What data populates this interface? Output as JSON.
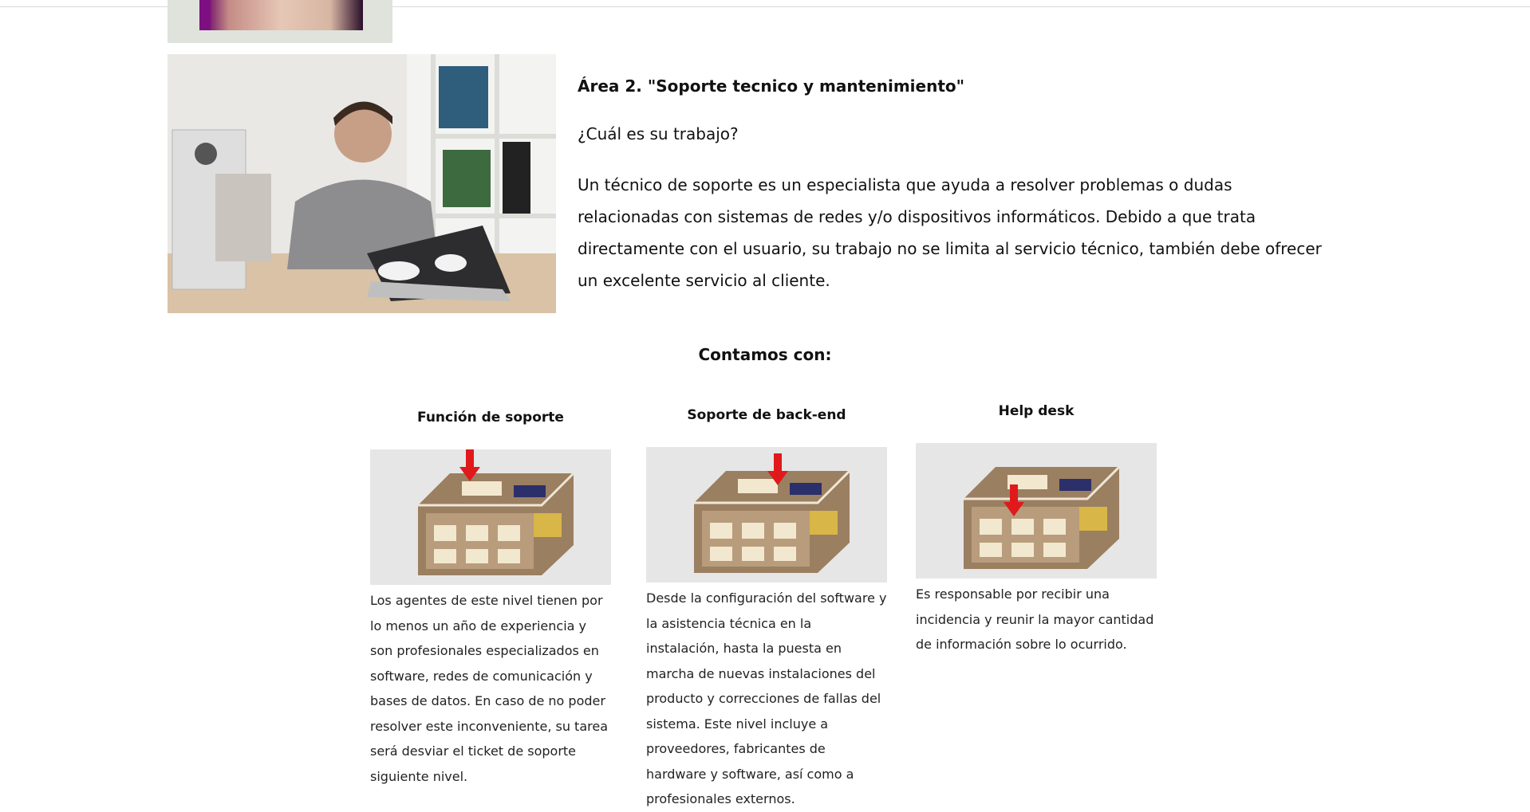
{
  "article": {
    "area_title": "Área 2. \"Soporte tecnico y mantenimiento\"",
    "question": "¿Cuál es su trabajo?",
    "body": "Un técnico de soporte es un especialista que ayuda a resolver problemas o dudas relacionadas con sistemas de redes y/o dispositivos informáticos. Debido a que trata directamente con el usuario, su trabajo no se limita al servicio técnico, también debe ofrecer un excelente servicio al cliente."
  },
  "section": {
    "heading": "Contamos con:"
  },
  "cards": [
    {
      "title": "Función de soporte",
      "text": "Los agentes de este nivel tienen por lo menos un año de experiencia y son profesionales especializados en software, redes de comunicación y bases de datos. En caso de no poder resolver este inconveniente, su tarea será desviar el ticket de soporte siguiente nivel."
    },
    {
      "title": "Soporte de back-end",
      "text": "Desde la configuración del software y la asistencia técnica en la instalación, hasta la puesta en marcha de nuevas instalaciones del producto y correcciones de fallas del sistema. Este nivel incluye a proveedores, fabricantes de hardware y software, así como a profesionales externos."
    },
    {
      "title": "Help desk",
      "text": "Es responsable por recibir una incidencia y reunir la mayor cantidad de información sobre lo ocurrido."
    }
  ],
  "colors": {
    "arrow": "#e0191b",
    "building_wall": "#9b7f61",
    "image_bg": "#e6e6e6"
  }
}
